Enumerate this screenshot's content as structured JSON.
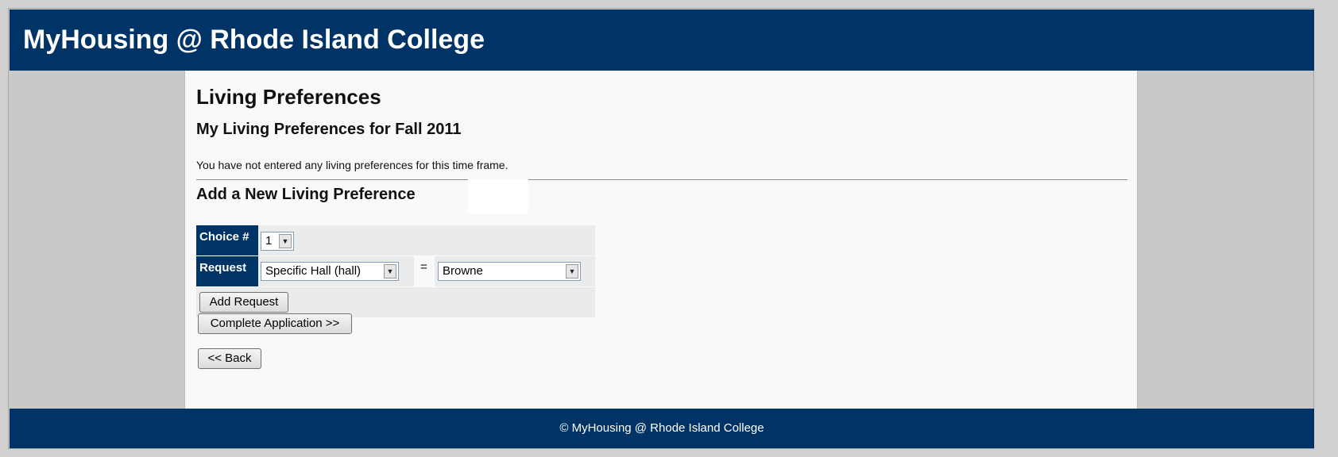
{
  "header": {
    "title": "MyHousing @ Rhode Island College"
  },
  "main": {
    "page_title": "Living Preferences",
    "current_heading": "My Living Preferences for Fall 2011",
    "notice": "You have not entered any living preferences for this time frame.",
    "add_heading": "Add a New Living Preference",
    "form": {
      "choice_label": "Choice #",
      "choice_value": "1",
      "request_label": "Request",
      "request_type_value": "Specific Hall (hall)",
      "equals": "=",
      "request_target_value": "Browne",
      "add_request_label": "Add Request"
    },
    "complete_button_label": "Complete Application >>",
    "back_button_label": "<< Back"
  },
  "footer": {
    "text": "© MyHousing @ Rhode Island College"
  },
  "colors": {
    "brand": "#003366",
    "background": "#c9c9c9",
    "content": "#f9f9f9"
  }
}
